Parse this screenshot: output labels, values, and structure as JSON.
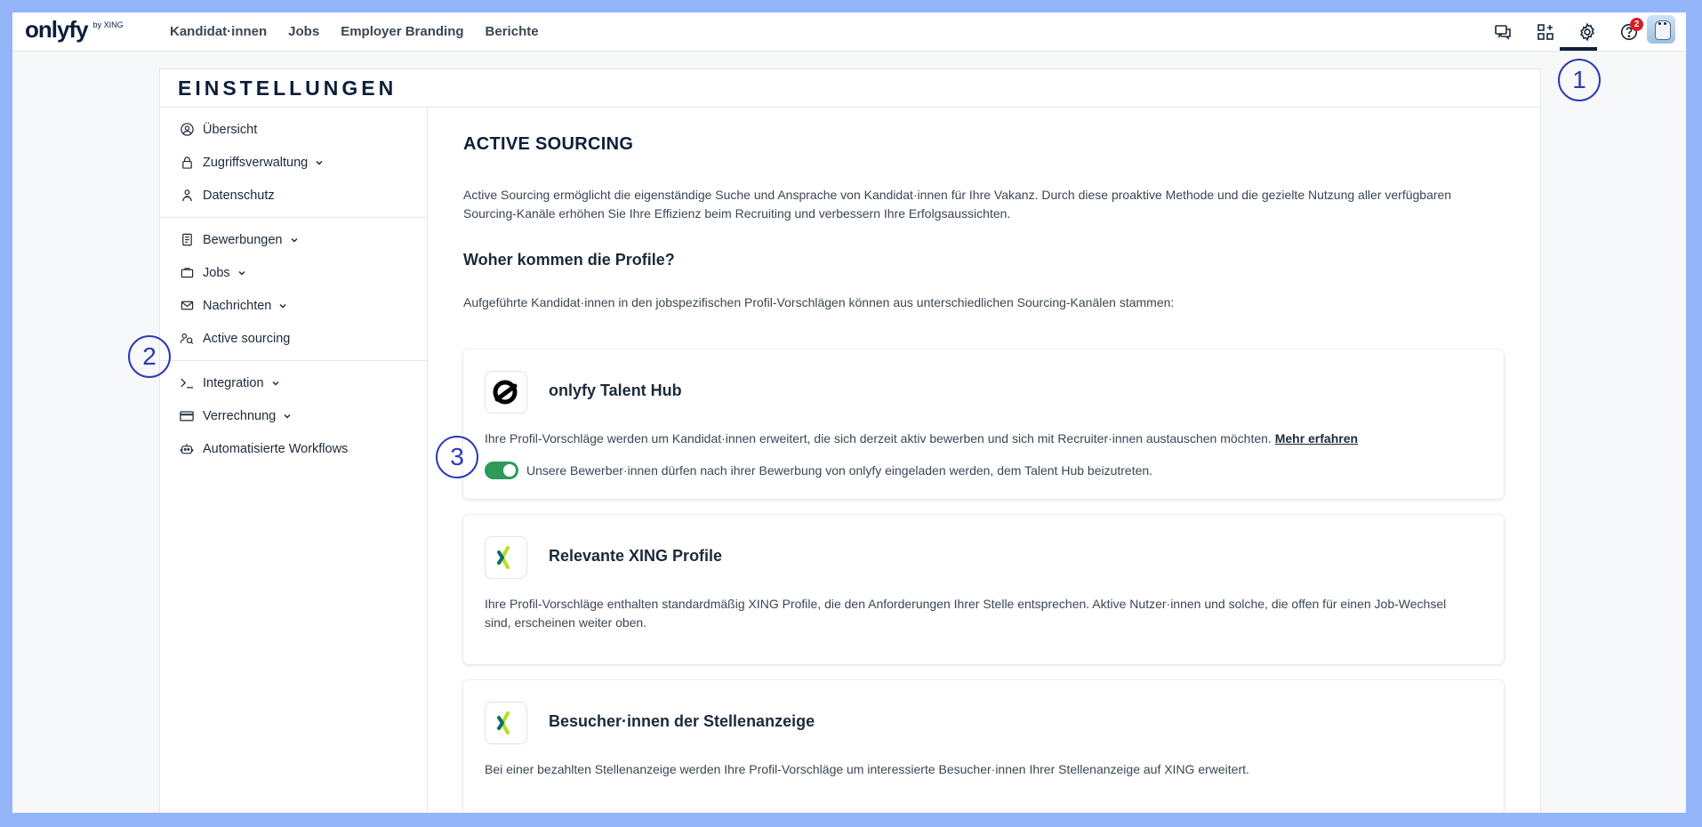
{
  "brand": {
    "logo_text": "onlyfy",
    "logo_sub": "by XING"
  },
  "nav": {
    "items": [
      "Kandidat·innen",
      "Jobs",
      "Employer Branding",
      "Berichte"
    ]
  },
  "top_icons": {
    "chat": "chat-icon",
    "apps": "apps-grid-icon",
    "settings": "gear-icon",
    "help": "help-icon",
    "help_badge": "2"
  },
  "annotations": {
    "one": "1",
    "two": "2",
    "three": "3"
  },
  "page": {
    "title": "EINSTELLUNGEN"
  },
  "sidebar": {
    "groups": [
      [
        {
          "label": "Übersicht",
          "icon": "user-circle-icon",
          "expandable": false
        },
        {
          "label": "Zugriffsverwaltung",
          "icon": "lock-icon",
          "expandable": true
        },
        {
          "label": "Datenschutz",
          "icon": "privacy-icon",
          "expandable": false
        }
      ],
      [
        {
          "label": "Bewerbungen",
          "icon": "document-icon",
          "expandable": true
        },
        {
          "label": "Jobs",
          "icon": "briefcase-icon",
          "expandable": true
        },
        {
          "label": "Nachrichten",
          "icon": "mail-icon",
          "expandable": true
        },
        {
          "label": "Active sourcing",
          "icon": "people-search-icon",
          "expandable": false
        }
      ],
      [
        {
          "label": "Integration",
          "icon": "terminal-icon",
          "expandable": true
        },
        {
          "label": "Verrechnung",
          "icon": "credit-card-icon",
          "expandable": true
        },
        {
          "label": "Automatisierte Workflows",
          "icon": "robot-icon",
          "expandable": false
        }
      ]
    ]
  },
  "main": {
    "heading": "ACTIVE SOURCING",
    "intro": "Active Sourcing ermöglicht die eigenständige Suche und Ansprache von Kandidat·innen für Ihre Vakanz. Durch diese proaktive Methode und die gezielte Nutzung aller verfügbaren Sourcing-Kanäle erhöhen Sie Ihre Effizienz beim Recruiting und verbessern Ihre Erfolgsaussichten.",
    "subheading": "Woher kommen die Profile?",
    "sub_text": "Aufgeführte Kandidat·innen in den jobspezifischen Profil-Vorschlägen können aus unterschiedlichen Sourcing-Kanälen stammen:",
    "sources": [
      {
        "title": "onlyfy Talent Hub",
        "text": "Ihre Profil-Vorschläge werden um Kandidat·innen erweitert, die sich derzeit aktiv bewerben und sich mit Recruiter·innen austauschen möchten.",
        "link": "Mehr erfahren",
        "toggle_label": "Unsere Bewerber·innen dürfen nach ihrer Bewerbung von onlyfy eingeladen werden, dem Talent Hub beizutreten.",
        "toggle_on": true,
        "logo": "onlyfy-logo-icon"
      },
      {
        "title": "Relevante XING Profile",
        "text": "Ihre Profil-Vorschläge enthalten standardmäßig XING Profile, die den Anforderungen Ihrer Stelle entsprechen. Aktive Nutzer·innen und solche, die offen für einen Job-Wechsel sind, erscheinen weiter oben.",
        "logo": "xing-logo-icon"
      },
      {
        "title": "Besucher·innen der Stellenanzeige",
        "text": "Bei einer bezahlten Stellenanzeige werden Ihre Profil-Vorschläge um interessierte Besucher·innen Ihrer Stellenanzeige auf XING erweitert.",
        "logo": "xing-logo-icon"
      }
    ]
  },
  "colors": {
    "accent": "#2b3ab3",
    "toggle": "#2d9a5a",
    "badge": "#d21f2a",
    "background": "#95b5fb",
    "xing_green": "#b7df1f",
    "xing_teal": "#0a6e64"
  }
}
